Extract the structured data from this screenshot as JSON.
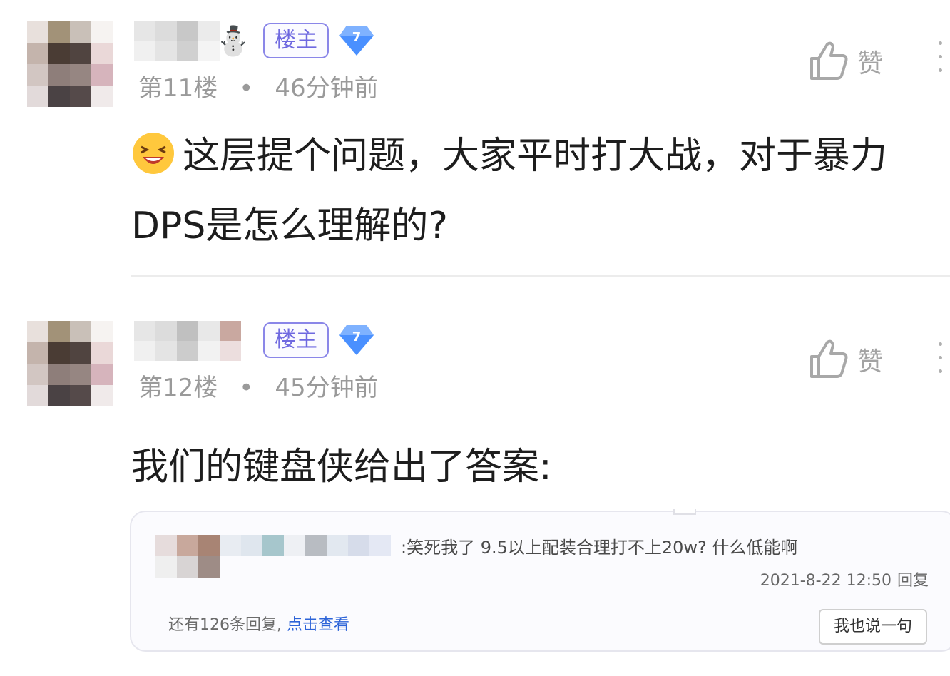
{
  "posts": [
    {
      "host_badge": "楼主",
      "level": "7",
      "floor": "第11楼",
      "separator": "•",
      "time": "46分钟前",
      "like_label": "赞",
      "content": "这层提个问题，大家平时打大战，对于暴力DPS是怎么理解的?"
    },
    {
      "host_badge": "楼主",
      "level": "7",
      "floor": "第12楼",
      "separator": "•",
      "time": "45分钟前",
      "like_label": "赞",
      "content": "我们的键盘侠给出了答案:"
    }
  ],
  "quote": {
    "text": ":笑死我了 9.5以上配装合理打不上20w? 什么低能啊",
    "time": "2021-8-22 12:50",
    "reply_label": "回复",
    "more_text": "还有126条回复,",
    "more_link": "点击查看",
    "reply_button": "我也说一句"
  },
  "colors": {
    "host_badge": "#6f69e0",
    "level_badge": "#4a90ff",
    "link": "#2d64d8"
  }
}
